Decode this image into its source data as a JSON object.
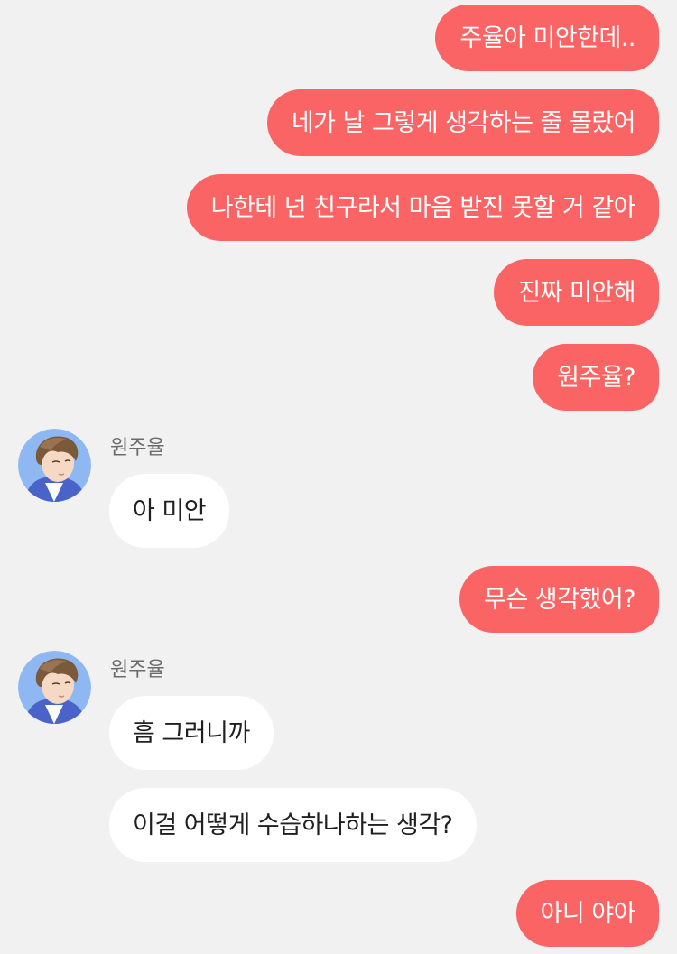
{
  "conversation": {
    "messages": [
      {
        "from": "me",
        "text": "주율아 미안한데.."
      },
      {
        "from": "me",
        "text": "네가 날 그렇게 생각하는 줄 몰랐어"
      },
      {
        "from": "me",
        "text": "나한테 넌 친구라서 마음 받진 못할 거 같아"
      },
      {
        "from": "me",
        "text": "진짜 미안해"
      },
      {
        "from": "me",
        "text": "원주율?"
      },
      {
        "from": "other",
        "sender": "원주율",
        "text": "아 미안"
      },
      {
        "from": "me",
        "text": "무슨 생각했어?"
      },
      {
        "from": "other",
        "sender": "원주율",
        "text": "흠 그러니까"
      },
      {
        "from": "other",
        "sender": "원주율",
        "text": "이걸 어떻게 수습하나하는 생각?"
      },
      {
        "from": "me",
        "text": "아니 야아"
      }
    ]
  },
  "colors": {
    "background": "#f1f1f1",
    "outgoing_bubble": "#fb6464",
    "incoming_bubble": "#ffffff"
  },
  "icons": {
    "avatar": "boy-avatar-icon"
  }
}
